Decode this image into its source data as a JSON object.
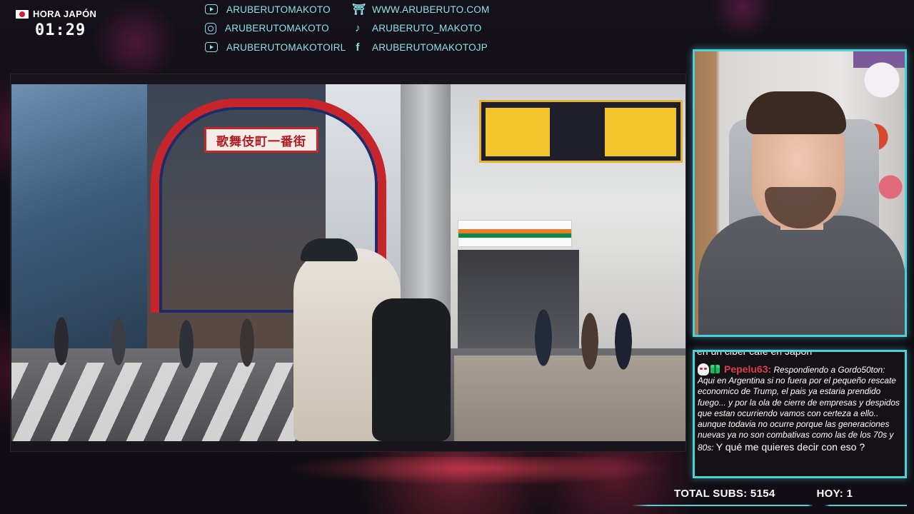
{
  "clock": {
    "label": "HORA JAPÓN",
    "time": "01:29",
    "flag_icon": "japan-flag-icon"
  },
  "socials": {
    "col1": [
      {
        "icon": "youtube-icon",
        "handle": "ARUBERUTOMAKOTO"
      },
      {
        "icon": "instagram-icon",
        "handle": "ARUBERUTOMAKOTO"
      },
      {
        "icon": "youtube-icon",
        "handle": "ARUBERUTOMAKOTOIRL"
      }
    ],
    "col2": [
      {
        "icon": "torii-gate-icon",
        "handle": "WWW.ARUBERUTO.COM"
      },
      {
        "icon": "tiktok-icon",
        "handle": "ARUBERUTO_MAKOTO"
      },
      {
        "icon": "facebook-icon",
        "handle": "ARUBERUTOMAKOTOJP"
      }
    ]
  },
  "video": {
    "arch_sign": "歌舞伎町一番街"
  },
  "chat": {
    "previous_fragment": "en un ciber cafe en Japon",
    "message": {
      "user": "Pepelu63:",
      "reply_text": "Respondiendo a Gordo50ton: Aqui en Argentina si no fuera por el pequeño rescate economico de Trump, el pais ya estaria prendido fuego... y por la ola de cierre de empresas y despidos que estan ocurriendo vamos con certeza a ello.. aunque todavia no ocurre porque las generaciones nuevas ya no son combativas como las de los 70s y 80s:",
      "text": "Y qué me quieres decir con eso ?"
    }
  },
  "stats": {
    "total_subs": "TOTAL SUBS: 5154",
    "today": "HOY: 1"
  },
  "colors": {
    "accent": "#4ecfd6",
    "social_text": "#8ee0e6",
    "username": "#e23c4b"
  }
}
